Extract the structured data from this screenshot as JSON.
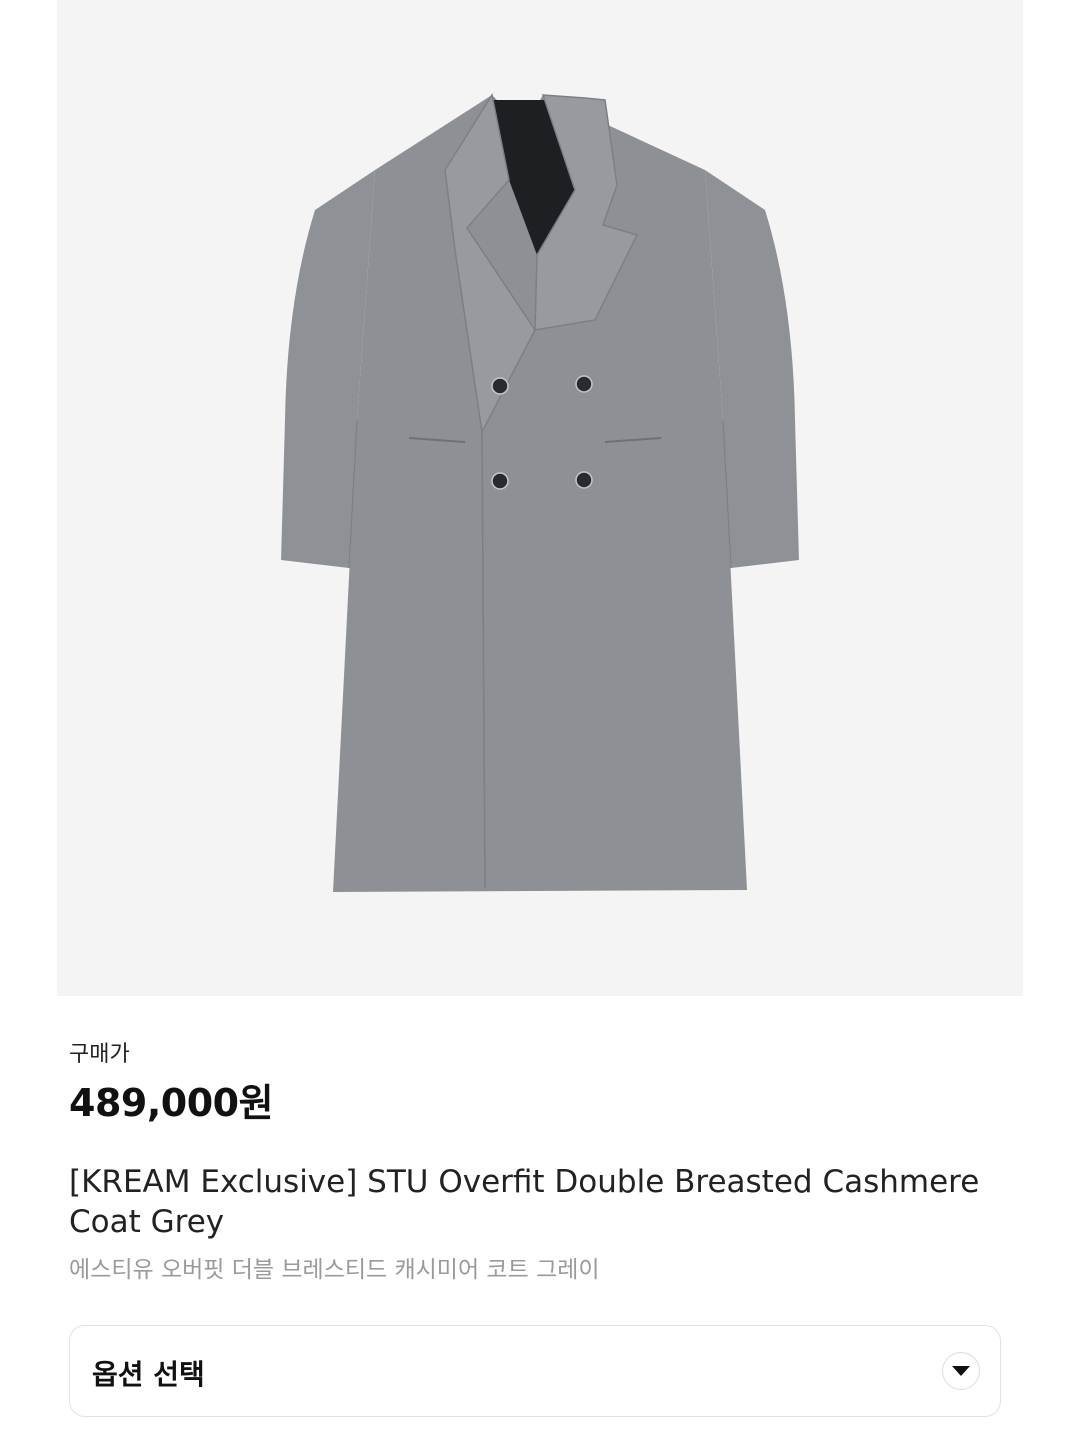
{
  "product": {
    "image_alt": "STU Overfit Double Breasted Cashmere Coat Grey",
    "image_background": "#f4f4f4",
    "coat_color": "#8d9196",
    "price_label": "구매가",
    "price": "489,000원",
    "title_en": "[KREAM Exclusive] STU Overfit Double Breasted Cashmere Coat Grey",
    "title_ko": "에스티유 오버핏 더블 브레스티드 캐시미어 코트 그레이"
  },
  "option_select": {
    "label": "옵션 선택",
    "icon": "chevron-down-icon"
  }
}
